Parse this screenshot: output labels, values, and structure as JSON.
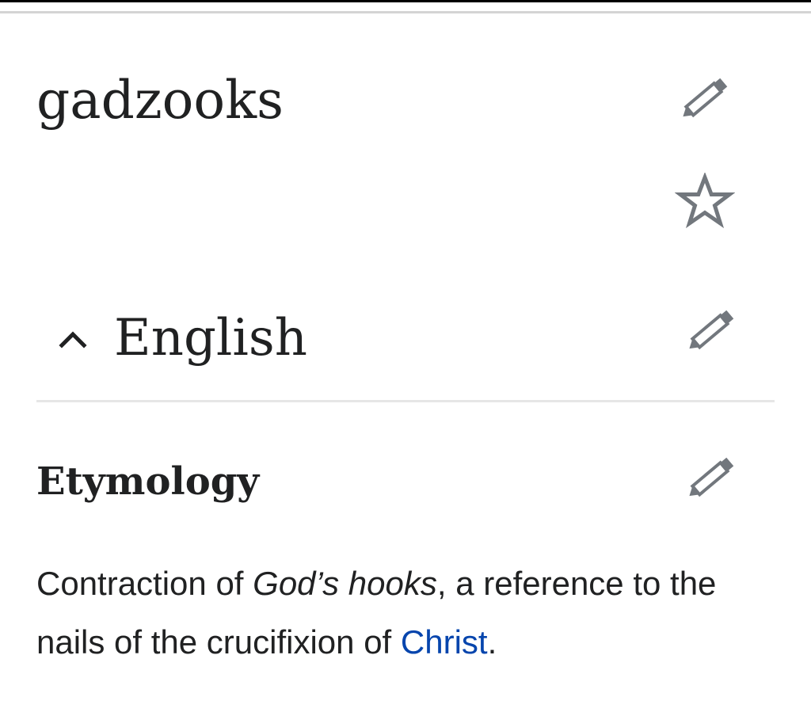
{
  "page": {
    "title": "gadzooks"
  },
  "actions": {
    "edit_icon": "pencil-icon",
    "watch_icon": "star-outline-icon"
  },
  "language_section": {
    "title": "English",
    "collapse_icon": "chevron-up-icon",
    "expanded": true
  },
  "etymology": {
    "heading": "Etymology",
    "text_before": "Contraction of ",
    "italic_term": "God’s hooks",
    "text_middle": ", a reference to the nails of the crucifixion of ",
    "link_text": "Christ",
    "text_after": "."
  },
  "colors": {
    "text": "#202122",
    "link": "#0645ad",
    "icon": "#72777d",
    "divider": "#e6e6e6"
  }
}
